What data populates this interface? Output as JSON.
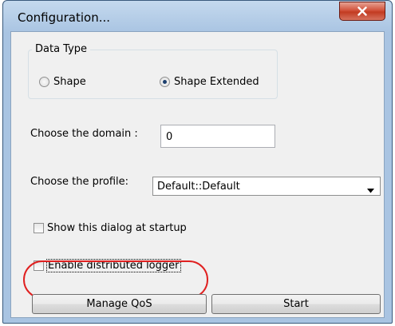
{
  "window": {
    "title": "Configuration..."
  },
  "data_type": {
    "legend": "Data Type",
    "options": [
      {
        "label": "Shape",
        "checked": false
      },
      {
        "label": "Shape Extended",
        "checked": true
      }
    ]
  },
  "domain": {
    "label": "Choose the domain :",
    "value": "0"
  },
  "profile": {
    "label": "Choose the profile:",
    "selected": "Default::Default"
  },
  "options": {
    "show_dialog_label": "Show this dialog at startup",
    "show_dialog_checked": false,
    "enable_logger_label": "Enable distributed logger",
    "enable_logger_checked": false
  },
  "buttons": {
    "manage_qos": "Manage QoS",
    "start": "Start"
  },
  "colors": {
    "title_bar": "#a9c4e2",
    "close_button": "#c23b22",
    "highlight": "#e02020",
    "client_bg": "#f0f0f0"
  }
}
